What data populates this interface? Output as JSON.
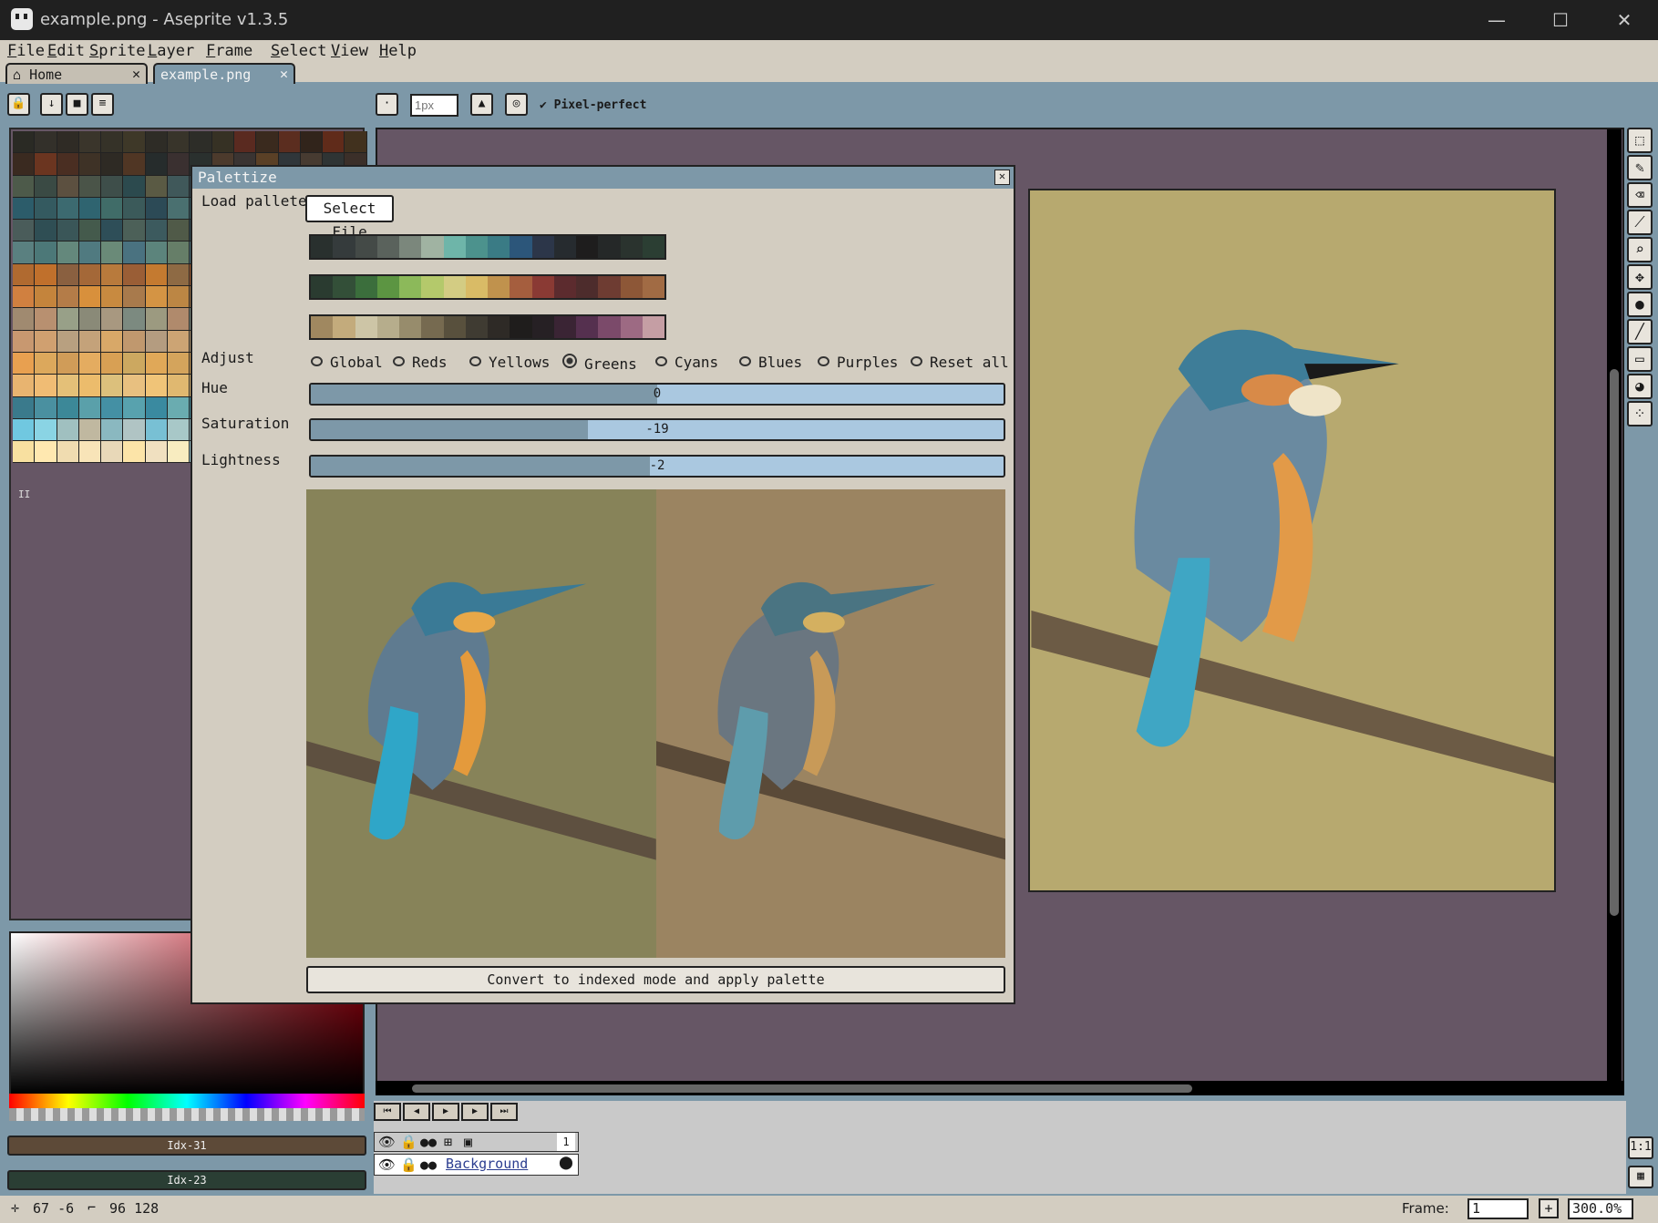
{
  "window": {
    "title": "example.png - Aseprite v1.3.5",
    "minimize_glyph": "—",
    "maximize_glyph": "☐",
    "close_glyph": "✕"
  },
  "menu": [
    "File",
    "Edit",
    "Sprite",
    "Layer",
    "Frame",
    "Select",
    "View",
    "Help"
  ],
  "tabs": [
    {
      "label": "Home",
      "icon": "home-icon",
      "close": "✕"
    },
    {
      "label": "example.png",
      "close": "✕",
      "active": true
    }
  ],
  "toolbar": {
    "brush_size_placeholder": "1px",
    "pixel_perfect_label": "Pixel-perfect",
    "pixel_perfect_checked": true
  },
  "palette_colors": [
    "#2a2a24",
    "#33302a",
    "#2f2b25",
    "#3a352b",
    "#353228",
    "#3e3828",
    "#2e2c26",
    "#38342a",
    "#2d2d28",
    "#363124",
    "#5a2a20",
    "#3a2a1e",
    "#5b2d1f",
    "#31241b",
    "#602b1a",
    "#41311e",
    "#3a2a20",
    "#6b3520",
    "#4a2e22",
    "#3e3226",
    "#2e2a24",
    "#503624",
    "#262c2c",
    "#3a3030",
    "#2a302e",
    "#4c3a2c",
    "#3a3432",
    "#5a4026",
    "#30363a",
    "#473b31",
    "#2f3434",
    "#3b2f29",
    "#4d5a4a",
    "#3a4a44",
    "#5c5040",
    "#4a5448",
    "#3e4e4a",
    "#2c4a4e",
    "#5a5a44",
    "#40585a",
    "#354a54",
    "#4a4434",
    "#60604a",
    "#4c6258",
    "#3e5658",
    "#586050",
    "#4c5a5e",
    "#5c6040",
    "#2c5c6a",
    "#345a60",
    "#3c6a70",
    "#2f6470",
    "#406c68",
    "#3b5a5a",
    "#2c4a56",
    "#4a7070",
    "#34606a",
    "#2b5260",
    "#3c6468",
    "#467474",
    "#2e5e6c",
    "#3a6a72",
    "#325864",
    "#407070",
    "#4a5c5a",
    "#2f4e54",
    "#3a5658",
    "#445a4c",
    "#2e4e58",
    "#4c6058",
    "#3c5a5e",
    "#505a48",
    "#32525c",
    "#4a625a",
    "#3e5656",
    "#586650",
    "#2c5060",
    "#485e56",
    "#3a585c",
    "#526048",
    "#5a8080",
    "#4c7878",
    "#64887c",
    "#507a80",
    "#6a8a78",
    "#4a7280",
    "#5c847c",
    "#667e68",
    "#4e7884",
    "#608670",
    "#58807c",
    "#6c8870",
    "#4a768a",
    "#5e8272",
    "#547c80",
    "#6a8064",
    "#b06a30",
    "#c0702c",
    "#8a6040",
    "#a46838",
    "#b87a3c",
    "#9a5e36",
    "#c47a30",
    "#8e6a44",
    "#b46434",
    "#a87040",
    "#c07838",
    "#946848",
    "#b86e30",
    "#a0683c",
    "#bc7a36",
    "#906444",
    "#d08040",
    "#c4843c",
    "#b47c48",
    "#d8903c",
    "#c88a40",
    "#a87a4c",
    "#d49444",
    "#bc8644",
    "#ac7c4c",
    "#d08c40",
    "#c48a48",
    "#b68250",
    "#d89840",
    "#c28c44",
    "#ae8050",
    "#d4903c",
    "#a08a70",
    "#b89070",
    "#98a088",
    "#8a8a78",
    "#a89880",
    "#7c8a80",
    "#9c9a80",
    "#b08a6c",
    "#88988c",
    "#a08e78",
    "#948c7c",
    "#aa9a7c",
    "#6a8a88",
    "#9c9480",
    "#de8b3e",
    "#8e9c8c",
    "#c89870",
    "#d0a070",
    "#b8a080",
    "#c4a27a",
    "#d8a868",
    "#c0986e",
    "#b49c80",
    "#cca474",
    "#bca078",
    "#c89c6c",
    "#d4a46c",
    "#b8a27e",
    "#c09a70",
    "#d0a272",
    "#c8a076",
    "#d4a86c",
    "#e8a050",
    "#dca85c",
    "#d09c58",
    "#e4ac60",
    "#d8a054",
    "#cca860",
    "#e0a858",
    "#d4a45c",
    "#e8b060",
    "#dcac58",
    "#d0a858",
    "#e4b464",
    "#d8a858",
    "#f0b86a",
    "#e0ac5c",
    "#f4c070",
    "#e8b470",
    "#f0bc74",
    "#e4c078",
    "#ecbc6c",
    "#dcc07c",
    "#e8c080",
    "#f0c478",
    "#e0b870",
    "#ecc47c",
    "#e4bc74",
    "#f0c880",
    "#e8c07c",
    "#f4cc84",
    "#e0c480",
    "#f0c878",
    "#f8d088",
    "#3a7a8c",
    "#4a90a0",
    "#3c8898",
    "#5aa0aa",
    "#4490a4",
    "#58a2ae",
    "#3a8aa0",
    "#6aacb0",
    "#4a98a8",
    "#5ca4b0",
    "#3e90a4",
    "#68b0b4",
    "#4c9cac",
    "#5eaab4",
    "#4494a8",
    "#70b4b8",
    "#70c8e0",
    "#8ad4e4",
    "#a0c0c0",
    "#c0b8a0",
    "#8ab8c0",
    "#b0c4c4",
    "#78c0d4",
    "#a8c8c8",
    "#9ac4cc",
    "#c4bca8",
    "#86c4d0",
    "#b8c4bc",
    "#80ccdc",
    "#a4ccd0",
    "#c8c0a8",
    "#90d0dc",
    "#f8e0a0",
    "#ffe8b0",
    "#f0dcb0",
    "#f8e4b8",
    "#e8d8b8",
    "#fce4a8",
    "#f0e0c0",
    "#f8ecc0",
    "#a8d8e0",
    "#b8e0e4",
    "#c8e4e0",
    "#98d0dc",
    "#d8e8d8",
    "#b0dce4",
    "#88d8ec",
    "#e0ecdc"
  ],
  "palette_handle": "II",
  "fg_color": {
    "label": "Idx-31",
    "hex": "#5d4a38"
  },
  "bg_color": {
    "label": "Idx-23",
    "hex": "#2a3e34"
  },
  "status": {
    "cursor": "67 -6",
    "size": "96 128",
    "frame_label": "Frame:",
    "frame_value": "1",
    "add_frame": "+",
    "zoom": "300.0%"
  },
  "timeline": {
    "frame_number": "1",
    "layer_name": "Background",
    "playback_glyphs": [
      "⏮",
      "◀",
      "▶",
      "▶",
      "⏭"
    ]
  },
  "right_tools": [
    "marquee-tool",
    "pencil-tool",
    "eraser-tool",
    "eyedropper-tool",
    "zoom-tool",
    "move-tool",
    "fill-tool",
    "line-tool",
    "rectangle-tool",
    "blur-tool",
    "spray-tool"
  ],
  "timeline_right_buttons": [
    "1:1",
    "▦"
  ],
  "dialog": {
    "title": "Palettize",
    "close": "✕",
    "load_palette_label": "Load pallete",
    "select_file": "Select File",
    "palettes": [
      [
        "#29302e",
        "#353b3c",
        "#444a47",
        "#5a625c",
        "#7b877c",
        "#a0b3a2",
        "#6eb5a9",
        "#4c928d",
        "#3a7b85",
        "#2c567a",
        "#2c3649",
        "#262b2f",
        "#1e1d1d",
        "#252828",
        "#2a332e",
        "#2b3e33"
      ],
      [
        "#2a3b30",
        "#334f38",
        "#3b6e3c",
        "#5c9542",
        "#8cb95a",
        "#b4c96b",
        "#d3cc83",
        "#d9bb66",
        "#c0924d",
        "#a55e3e",
        "#8a3a34",
        "#5c2b2e",
        "#4d2c2c",
        "#6e3c32",
        "#8d5737",
        "#a16b44"
      ],
      [
        "#a08860",
        "#c3ab7c",
        "#cdc5a6",
        "#b6ad8c",
        "#978c6c",
        "#766a50",
        "#58503d",
        "#3f3b32",
        "#2e2a26",
        "#1f1d1c",
        "#262024",
        "#3a2434",
        "#55304f",
        "#7b4a6a",
        "#9d6a83",
        "#c59ea4"
      ]
    ],
    "adjust_label": "Adjust",
    "adjust_options": [
      "Global",
      "Reds",
      "Yellows",
      "Greens",
      "Cyans",
      "Blues",
      "Purples",
      "Reset all"
    ],
    "adjust_selected": "Greens",
    "sliders": [
      {
        "label": "Hue",
        "value": "0",
        "fraction": 0.5
      },
      {
        "label": "Saturation",
        "value": "-19",
        "fraction": 0.4
      },
      {
        "label": "Lightness",
        "value": "-2",
        "fraction": 0.49
      }
    ],
    "apply_label": "Convert to indexed mode and apply palette"
  }
}
